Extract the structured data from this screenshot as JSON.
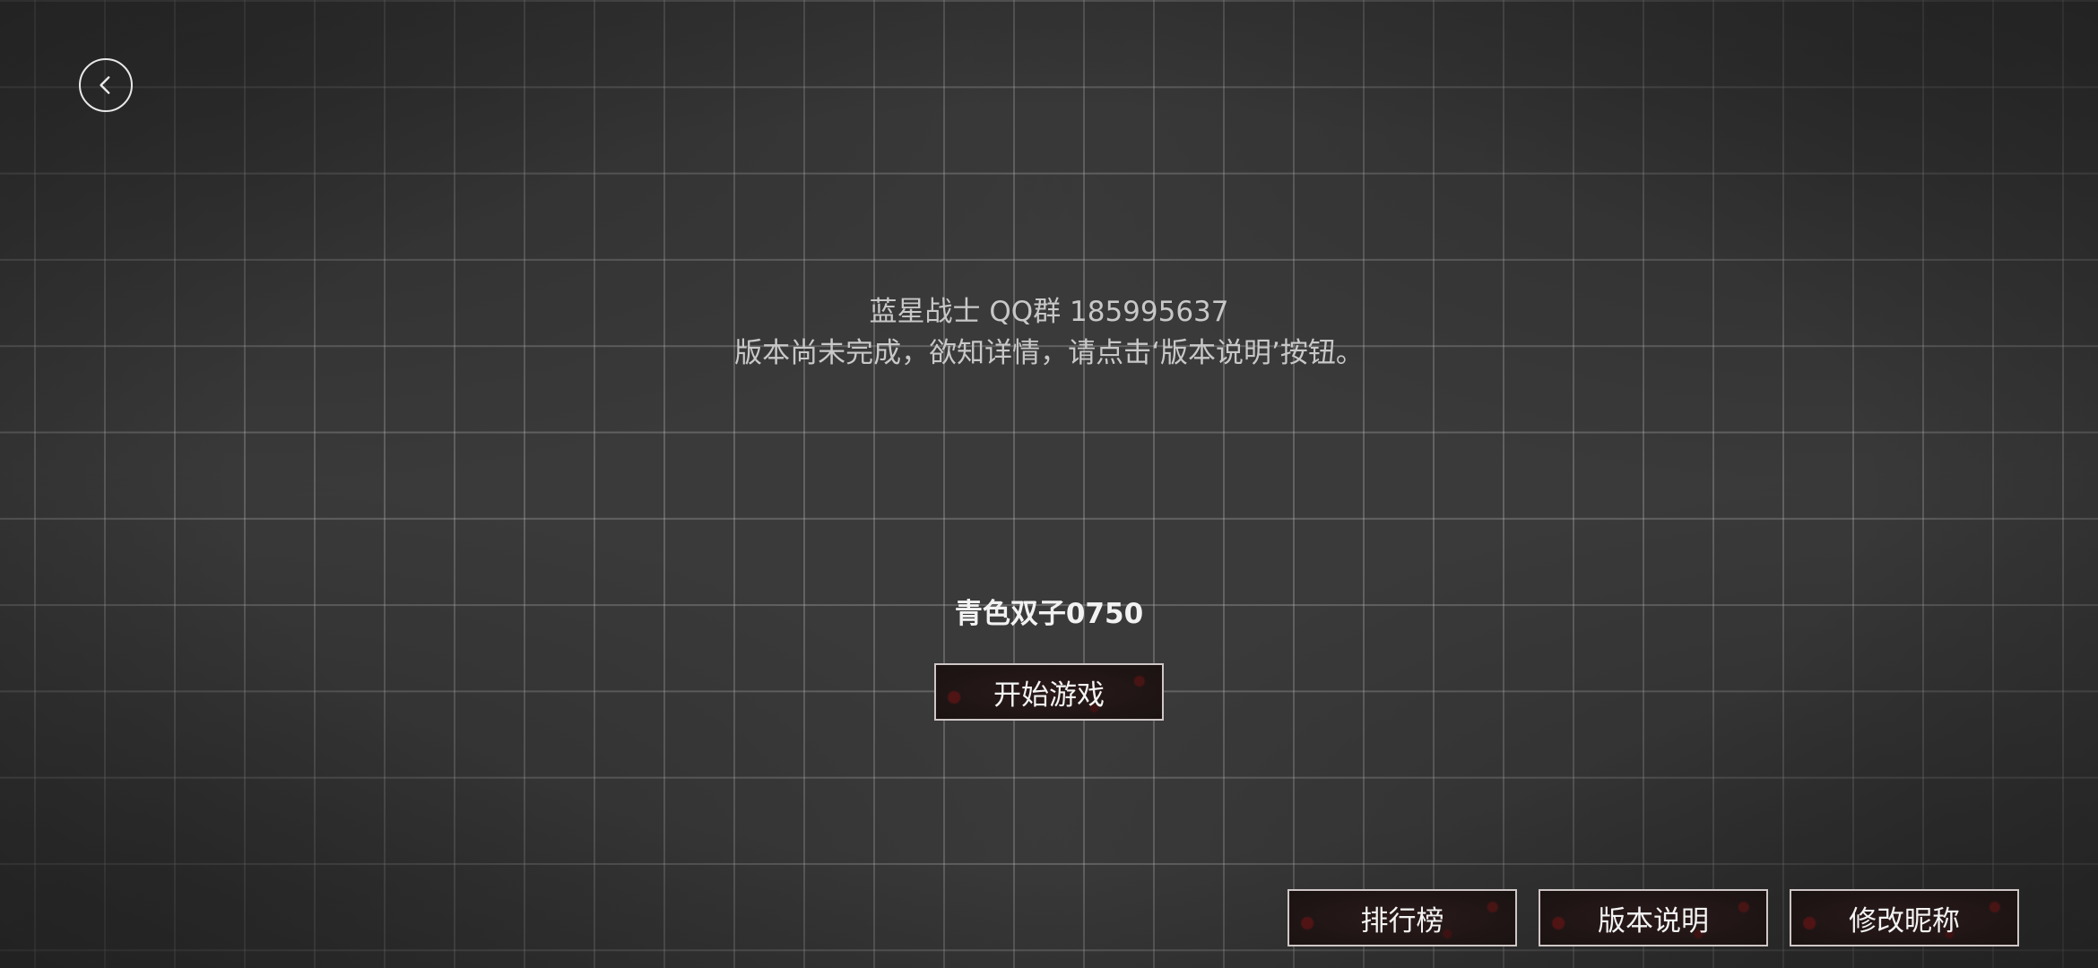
{
  "back_button": {
    "icon": "chevron-left-icon"
  },
  "info": {
    "line1": "蓝星战士 QQ群 185995637",
    "line2": "版本尚未完成，欲知详情，请点击‘版本说明’按钮。"
  },
  "player": {
    "name": "青色双子0750"
  },
  "buttons": {
    "start": "开始游戏",
    "leaderboard": "排行榜",
    "version_notes": "版本说明",
    "change_nickname": "修改昵称"
  }
}
